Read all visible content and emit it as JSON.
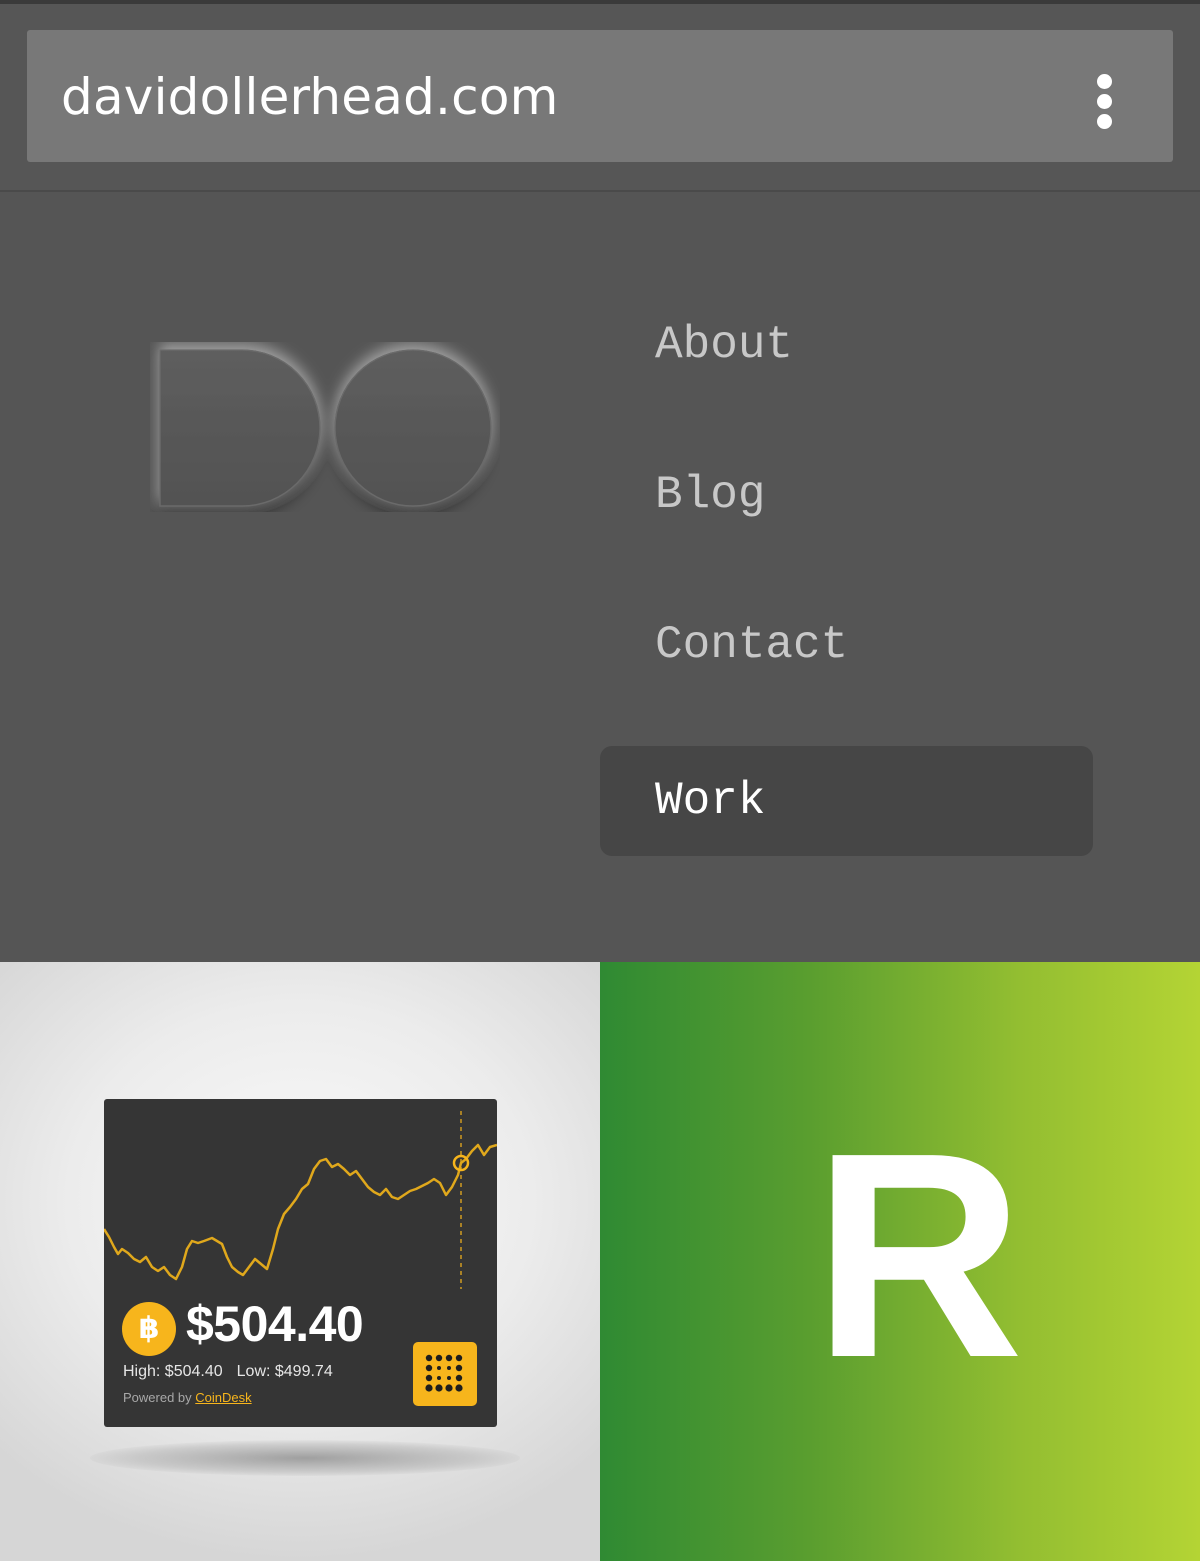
{
  "browser": {
    "url": "davidollerhead.com",
    "menu_icon": "more-vertical-icon"
  },
  "site": {
    "logo_text": "DO",
    "nav": [
      {
        "label": "About",
        "active": false
      },
      {
        "label": "Blog",
        "active": false
      },
      {
        "label": "Contact",
        "active": false
      },
      {
        "label": "Work",
        "active": true
      }
    ]
  },
  "work": {
    "tiles": [
      {
        "name": "bitcoin-widget",
        "price": "$504.40",
        "high_label": "High: $504.40",
        "low_label": "Low: $499.74",
        "powered_prefix": "Powered by",
        "powered_brand": "CoinDesk",
        "coin_icon": "bitcoin-icon",
        "app_icon": "dot-grid-icon"
      },
      {
        "name": "r-logo",
        "letter": "R"
      }
    ]
  },
  "colors": {
    "accent_gold": "#f7b51c",
    "nav_active_bg": "#464646",
    "page_bg": "#555555",
    "green_start": "#2f8a33",
    "green_end": "#b4d434"
  }
}
